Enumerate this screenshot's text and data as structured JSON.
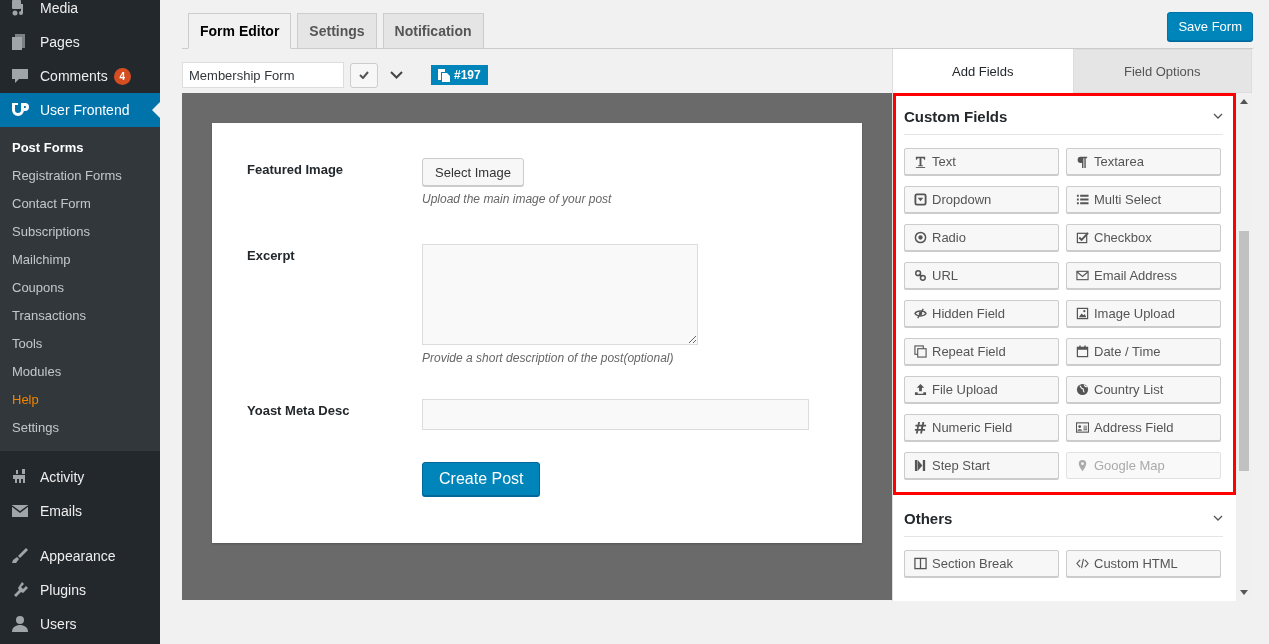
{
  "sidebar": {
    "menu_top": [
      {
        "label": "Media"
      },
      {
        "label": "Pages"
      },
      {
        "label": "Comments",
        "badge": "4"
      },
      {
        "label": "User Frontend",
        "selected": true
      }
    ],
    "submenu": [
      {
        "label": "Post Forms",
        "selected": true,
        "highlighted": false
      },
      {
        "label": "Registration Forms",
        "selected": false,
        "highlighted": false
      },
      {
        "label": "Contact Form",
        "selected": false,
        "highlighted": false
      },
      {
        "label": "Subscriptions",
        "selected": false,
        "highlighted": false
      },
      {
        "label": "Mailchimp",
        "selected": false,
        "highlighted": false
      },
      {
        "label": "Coupons",
        "selected": false,
        "highlighted": false
      },
      {
        "label": "Transactions",
        "selected": false,
        "highlighted": false
      },
      {
        "label": "Tools",
        "selected": false,
        "highlighted": false
      },
      {
        "label": "Modules",
        "selected": false,
        "highlighted": false
      },
      {
        "label": "Help",
        "selected": false,
        "highlighted": true
      },
      {
        "label": "Settings",
        "selected": false,
        "highlighted": false
      }
    ],
    "menu_middle": [
      {
        "label": "Activity"
      },
      {
        "label": "Emails"
      }
    ],
    "menu_bottom": [
      {
        "label": "Appearance"
      },
      {
        "label": "Plugins"
      },
      {
        "label": "Users"
      }
    ]
  },
  "tabs": [
    {
      "label": "Form Editor",
      "selected": true
    },
    {
      "label": "Settings",
      "selected": false
    },
    {
      "label": "Notification",
      "selected": false
    }
  ],
  "save_button": "Save Form",
  "form_name": {
    "value": "Membership Form"
  },
  "form_id_badge": "#197",
  "preview": {
    "fields": [
      {
        "label": "Featured Image",
        "kind": "image",
        "button": "Select Image",
        "help": "Upload the main image of your post"
      },
      {
        "label": "Excerpt",
        "kind": "textarea",
        "help": "Provide a short description of the post(optional)"
      },
      {
        "label": "Yoast Meta Desc",
        "kind": "text"
      }
    ],
    "submit": "Create Post"
  },
  "panel_tabs": [
    {
      "label": "Add Fields",
      "selected": true
    },
    {
      "label": "Field Options",
      "selected": false
    }
  ],
  "sections": [
    {
      "title": "Custom Fields",
      "highlighted": true,
      "fields": [
        {
          "label": "Text",
          "disabled": false
        },
        {
          "label": "Textarea",
          "disabled": false
        },
        {
          "label": "Dropdown",
          "disabled": false
        },
        {
          "label": "Multi Select",
          "disabled": false
        },
        {
          "label": "Radio",
          "disabled": false
        },
        {
          "label": "Checkbox",
          "disabled": false
        },
        {
          "label": "URL",
          "disabled": false
        },
        {
          "label": "Email Address",
          "disabled": false
        },
        {
          "label": "Hidden Field",
          "disabled": false
        },
        {
          "label": "Image Upload",
          "disabled": false
        },
        {
          "label": "Repeat Field",
          "disabled": false
        },
        {
          "label": "Date / Time",
          "disabled": false
        },
        {
          "label": "File Upload",
          "disabled": false
        },
        {
          "label": "Country List",
          "disabled": false
        },
        {
          "label": "Numeric Field",
          "disabled": false
        },
        {
          "label": "Address Field",
          "disabled": false
        },
        {
          "label": "Step Start",
          "disabled": false
        },
        {
          "label": "Google Map",
          "disabled": true
        }
      ]
    },
    {
      "title": "Others",
      "highlighted": false,
      "fields": [
        {
          "label": "Section Break",
          "disabled": false
        },
        {
          "label": "Custom HTML",
          "disabled": false
        }
      ]
    }
  ]
}
